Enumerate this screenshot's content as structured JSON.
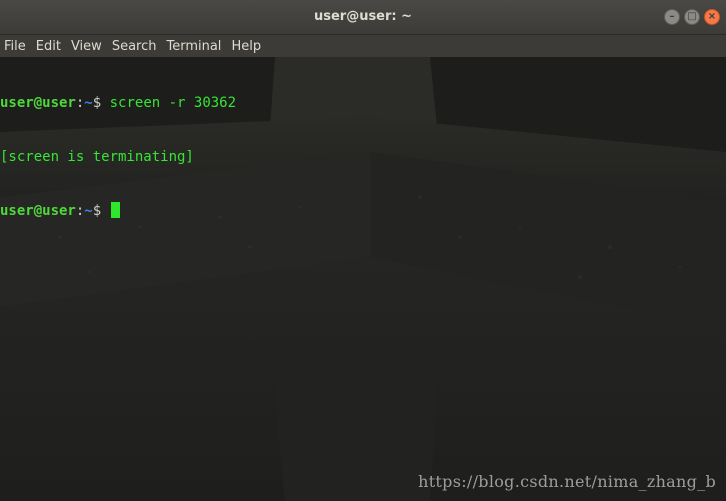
{
  "window": {
    "title": "user@user: ~",
    "buttons": {
      "minimize_icon": "minimize-icon",
      "maximize_icon": "maximize-icon",
      "close_icon": "close-icon"
    }
  },
  "menubar": {
    "items": [
      "File",
      "Edit",
      "View",
      "Search",
      "Terminal",
      "Help"
    ]
  },
  "terminal": {
    "lines": [
      {
        "user_host": "user@user",
        "sep": ":",
        "path": "~",
        "symbol": "$",
        "command": " screen -r 30362"
      },
      {
        "output": "[screen is terminating]"
      },
      {
        "user_host": "user@user",
        "sep": ":",
        "path": "~",
        "symbol": "$",
        "command": " "
      }
    ]
  },
  "watermark": "https://blog.csdn.net/nima_zhang_b",
  "colors": {
    "prompt_user": "#4ed83b",
    "prompt_path": "#3b82e6",
    "command_text": "#36e633",
    "cursor": "#2ee62a",
    "titlebar": "#3c3b37",
    "close_button": "#f47a4c"
  }
}
